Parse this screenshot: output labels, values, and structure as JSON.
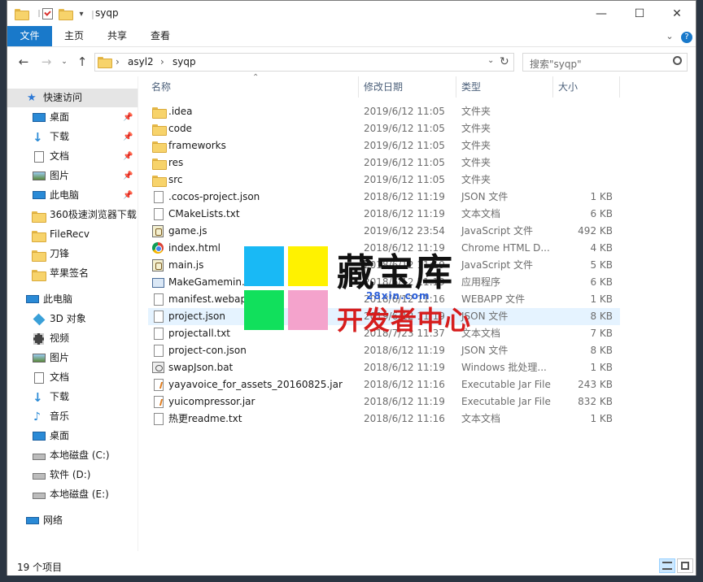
{
  "window": {
    "title": "syqp",
    "controls": {
      "minimize": "—",
      "maximize": "☐",
      "close": "✕"
    }
  },
  "ribbon": {
    "tabs": [
      "文件",
      "主页",
      "共享",
      "查看"
    ]
  },
  "address": {
    "segments": [
      "asyl2",
      "syqp"
    ],
    "search_placeholder": "搜索\"syqp\""
  },
  "nav": {
    "quick_access": {
      "label": "快速访问",
      "items": [
        {
          "label": "桌面",
          "icon": "desktop-icon",
          "pinned": true
        },
        {
          "label": "下载",
          "icon": "download-icon",
          "pinned": true
        },
        {
          "label": "文档",
          "icon": "document-icon",
          "pinned": true
        },
        {
          "label": "图片",
          "icon": "picture-icon",
          "pinned": true
        },
        {
          "label": "此电脑",
          "icon": "computer-icon",
          "pinned": true
        },
        {
          "label": "360极速浏览器下载",
          "icon": "folder-icon",
          "pinned": false
        },
        {
          "label": "FileRecv",
          "icon": "folder-icon",
          "pinned": false
        },
        {
          "label": "刀锋",
          "icon": "folder-icon",
          "pinned": false
        },
        {
          "label": "苹果签名",
          "icon": "folder-icon",
          "pinned": false
        }
      ]
    },
    "this_pc": {
      "label": "此电脑",
      "items": [
        {
          "label": "3D 对象",
          "icon": "3d-objects-icon"
        },
        {
          "label": "视频",
          "icon": "video-icon"
        },
        {
          "label": "图片",
          "icon": "picture-icon"
        },
        {
          "label": "文档",
          "icon": "document-icon"
        },
        {
          "label": "下载",
          "icon": "download-icon"
        },
        {
          "label": "音乐",
          "icon": "music-icon"
        },
        {
          "label": "桌面",
          "icon": "desktop-icon"
        },
        {
          "label": "本地磁盘 (C:)",
          "icon": "drive-icon"
        },
        {
          "label": "软件 (D:)",
          "icon": "drive-icon"
        },
        {
          "label": "本地磁盘 (E:)",
          "icon": "drive-icon"
        }
      ]
    },
    "network": {
      "label": "网络"
    }
  },
  "columns": {
    "name": "名称",
    "modified": "修改日期",
    "type": "类型",
    "size": "大小"
  },
  "files": [
    {
      "name": ".idea",
      "date": "2019/6/12 11:05",
      "type": "文件夹",
      "size": "",
      "icon": "folder"
    },
    {
      "name": "code",
      "date": "2019/6/12 11:05",
      "type": "文件夹",
      "size": "",
      "icon": "folder"
    },
    {
      "name": "frameworks",
      "date": "2019/6/12 11:05",
      "type": "文件夹",
      "size": "",
      "icon": "folder"
    },
    {
      "name": "res",
      "date": "2019/6/12 11:05",
      "type": "文件夹",
      "size": "",
      "icon": "folder"
    },
    {
      "name": "src",
      "date": "2019/6/12 11:05",
      "type": "文件夹",
      "size": "",
      "icon": "folder"
    },
    {
      "name": ".cocos-project.json",
      "date": "2018/6/12 11:19",
      "type": "JSON 文件",
      "size": "1 KB",
      "icon": "doc"
    },
    {
      "name": "CMakeLists.txt",
      "date": "2018/6/12 11:19",
      "type": "文本文档",
      "size": "6 KB",
      "icon": "doc"
    },
    {
      "name": "game.js",
      "date": "2019/6/12 23:54",
      "type": "JavaScript 文件",
      "size": "492 KB",
      "icon": "js"
    },
    {
      "name": "index.html",
      "date": "2018/6/12 11:19",
      "type": "Chrome HTML D...",
      "size": "4 KB",
      "icon": "chrome"
    },
    {
      "name": "main.js",
      "date": "2018/6/12 11:19",
      "type": "JavaScript 文件",
      "size": "5 KB",
      "icon": "js"
    },
    {
      "name": "MakeGamemin.e",
      "date": "2018/6/12 11:19",
      "type": "应用程序",
      "size": "6 KB",
      "icon": "exe"
    },
    {
      "name": "manifest.webapp",
      "date": "2018/6/12 11:16",
      "type": "WEBAPP 文件",
      "size": "1 KB",
      "icon": "doc"
    },
    {
      "name": "project.json",
      "date": "2019/6/12 11:19",
      "type": "JSON 文件",
      "size": "8 KB",
      "icon": "doc"
    },
    {
      "name": "projectall.txt",
      "date": "2018/7/23 11:37",
      "type": "文本文档",
      "size": "7 KB",
      "icon": "doc"
    },
    {
      "name": "project-con.json",
      "date": "2018/6/12 11:19",
      "type": "JSON 文件",
      "size": "8 KB",
      "icon": "doc"
    },
    {
      "name": "swapJson.bat",
      "date": "2018/6/12 11:19",
      "type": "Windows 批处理...",
      "size": "1 KB",
      "icon": "bat"
    },
    {
      "name": "yayavoice_for_assets_20160825.jar",
      "date": "2018/6/12 11:16",
      "type": "Executable Jar File",
      "size": "243 KB",
      "icon": "jar"
    },
    {
      "name": "yuicompressor.jar",
      "date": "2018/6/12 11:19",
      "type": "Executable Jar File",
      "size": "832 KB",
      "icon": "jar"
    },
    {
      "name": "热更readme.txt",
      "date": "2018/6/12 11:16",
      "type": "文本文档",
      "size": "1 KB",
      "icon": "doc"
    }
  ],
  "selected_file": "project.json",
  "status": {
    "count": "19 个项目"
  },
  "watermark": {
    "line1": "藏宝库",
    "line2": "28xin.com",
    "line3": "开发者中心"
  },
  "colors": {
    "accent": "#1979ca",
    "selection": "#e5f3ff",
    "folder": "#f7d36b"
  }
}
